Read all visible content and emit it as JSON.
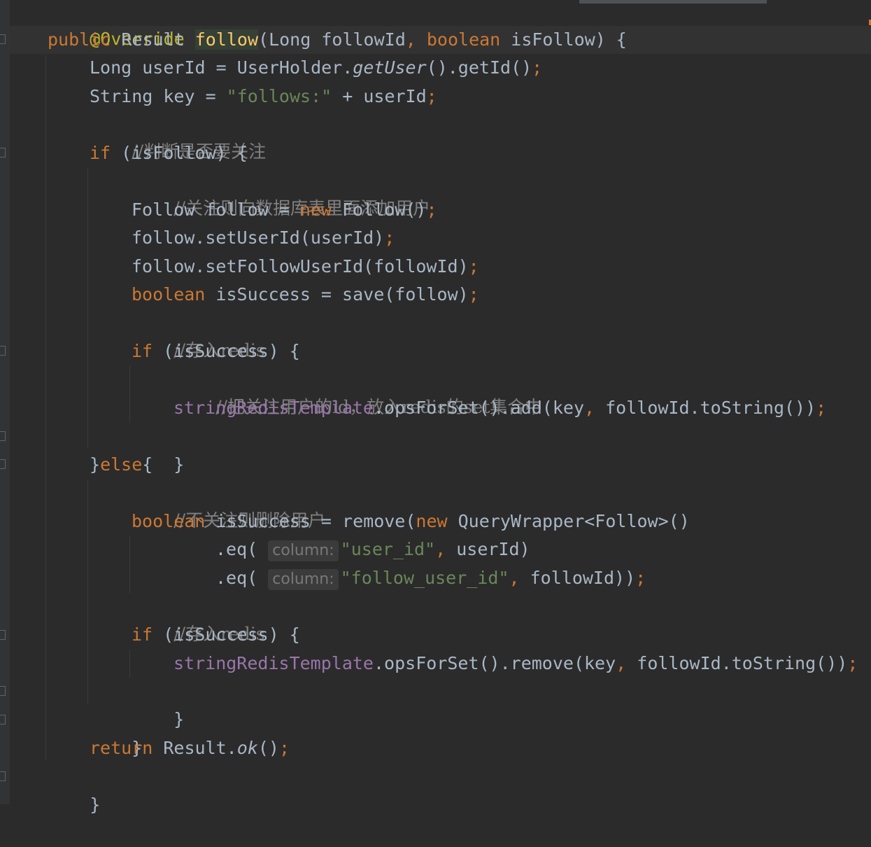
{
  "code_lines": [
    {
      "key": "l0",
      "text": "@Override"
    },
    {
      "key": "l1",
      "text": "public Result follow(Long followId, boolean isFollow) {"
    },
    {
      "key": "l2",
      "text": "Long userId = UserHolder.getUser().getId();"
    },
    {
      "key": "l3",
      "text": "String key = \"follows:\" + userId;"
    },
    {
      "key": "l4",
      "text": "//判断是否要关注"
    },
    {
      "key": "l5",
      "text": "if (isFollow) {"
    },
    {
      "key": "l6",
      "text": "//关注则向数据库表里面添加用户"
    },
    {
      "key": "l7",
      "text": "Follow follow = new Follow();"
    },
    {
      "key": "l8",
      "text": "follow.setUserId(userId);"
    },
    {
      "key": "l9",
      "text": "follow.setFollowUserId(followId);"
    },
    {
      "key": "l10",
      "text": "boolean isSuccess = save(follow);"
    },
    {
      "key": "l11",
      "text": "//存入redis"
    },
    {
      "key": "l12",
      "text": "if (isSuccess) {"
    },
    {
      "key": "l13",
      "text": "//把关注用户的id，放入redis的set集合中"
    },
    {
      "key": "l14",
      "text": "stringRedisTemplate.opsForSet().add(key, followId.toString());"
    },
    {
      "key": "l15",
      "text": "}"
    },
    {
      "key": "l16",
      "text": "}else{"
    },
    {
      "key": "l17",
      "text": "//不关注则删除用户"
    },
    {
      "key": "l18",
      "text": "boolean isSuccess = remove(new QueryWrapper<Follow>()"
    },
    {
      "key": "l19",
      "text": ".eq( column: \"user_id\", userId)"
    },
    {
      "key": "l20",
      "text": ".eq( column: \"follow_user_id\", followId));"
    },
    {
      "key": "l21",
      "text": "//存入redis"
    },
    {
      "key": "l22",
      "text": "if (isSuccess) {"
    },
    {
      "key": "l23",
      "text": "stringRedisTemplate.opsForSet().remove(key, followId.toString());"
    },
    {
      "key": "l24",
      "text": "}"
    },
    {
      "key": "l25",
      "text": "}"
    },
    {
      "key": "l26",
      "text": "return Result.ok();"
    },
    {
      "key": "l27",
      "text": "}"
    }
  ],
  "inlay_hint_label": "column:",
  "colors": {
    "background": "#2b2b2b",
    "keyword": "#cc7832",
    "string": "#6a8759",
    "comment": "#808080",
    "field": "#9876aa",
    "method_declaration": "#ffc66d",
    "annotation": "#bbb529",
    "default_text": "#a9b7c6"
  },
  "icons": [
    "fold-marker-icon"
  ]
}
